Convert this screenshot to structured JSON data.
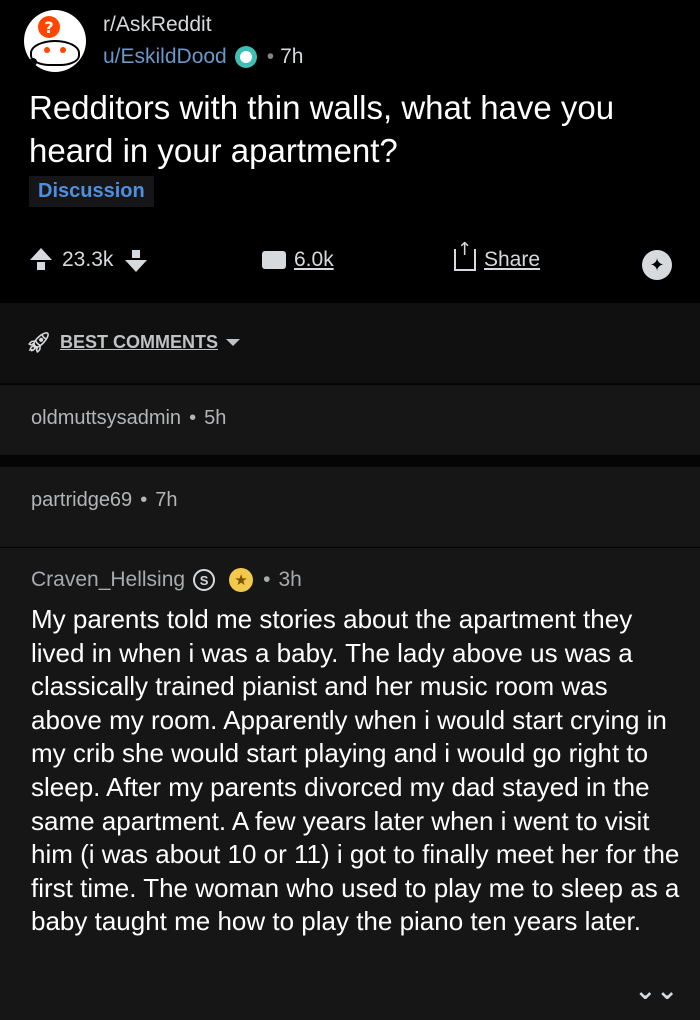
{
  "post": {
    "subreddit": "r/AskReddit",
    "author": "u/EskildDood",
    "time": "7h",
    "title": "Redditors with thin walls, what have you heard in your apartment?",
    "flair": "Discussion",
    "upvotes": "23.3k",
    "comments": "6.0k",
    "share_label": "Share"
  },
  "sort": {
    "label": "BEST COMMENTS"
  },
  "collapsed_comments": [
    {
      "author": "oldmuttsysadmin",
      "time": "5h"
    },
    {
      "author": "partridge69",
      "time": "7h"
    }
  ],
  "comment": {
    "author": "Craven_Hellsing",
    "badge": "S",
    "time": "3h",
    "body": "My parents told me stories about the apartment they lived in when i was a baby. The lady above us was a classically trained pianist and her music room was above my room. Apparently when i would start crying in my crib she would start playing and i would go right to sleep. After my parents divorced my dad stayed in the same apartment. A few years later when i went to visit him (i was about 10 or 11) i got to finally meet her for the first time. The woman who used to play me to sleep as a baby taught me how to play the piano ten years later."
  },
  "icons": {
    "avatar": "askreddit-snoo-icon",
    "upvote": "upvote-arrow-icon",
    "downvote": "downvote-arrow-icon",
    "comments": "comment-bubble-icon",
    "share": "share-icon",
    "award": "award-icon",
    "sort": "rocket-icon",
    "expand": "chevron-double-down-icon"
  },
  "colors": {
    "background": "#000000",
    "panel": "#161617",
    "author_link": "#6a98c9",
    "flair_text": "#4f8fe0",
    "avatar_accent": "#ff4500"
  }
}
